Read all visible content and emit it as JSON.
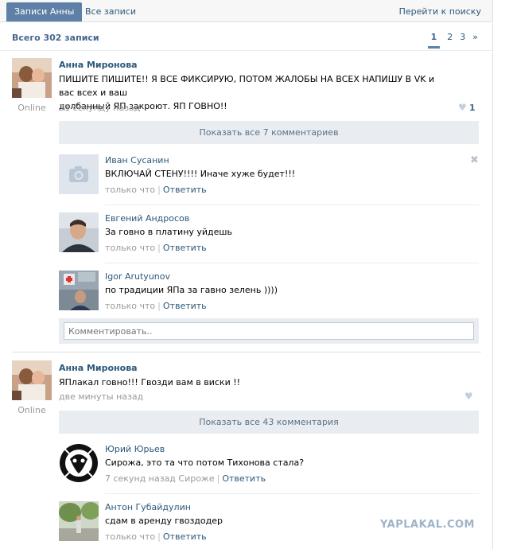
{
  "tabs": {
    "active": "Записи Анны",
    "all": "Все записи",
    "search": "Перейти к поиску"
  },
  "summary": {
    "total": "Всего 302 записи"
  },
  "pager": {
    "pages": [
      "1",
      "2",
      "3",
      "»"
    ],
    "current": "1"
  },
  "posts": [
    {
      "author": "Анна Миронова",
      "status": "Online",
      "text_line1": "ПИШИТЕ ПИШИТЕ!! Я ВСЕ ФИКСИРУЮ, ПОТОМ ЖАЛОБЫ НА ВСЕХ НАПИШУ В VK и вас всех и ваш",
      "text_line2": "долбанный ЯП закроют. ЯП ГОВНО!!",
      "time": "31 секунду назад",
      "likes": "1",
      "show_all": "Показать все 7 комментариев",
      "comments": [
        {
          "author": "Иван Сусанин",
          "text": "ВКЛЮЧАЙ СТЕНУ!!!! Иначе хуже будет!!!",
          "time": "только что",
          "reply": "Ответить"
        },
        {
          "author": "Евгений Андросов",
          "text": "За говно в платину уйдешь",
          "time": "только что",
          "reply": "Ответить"
        },
        {
          "author": "Igor Arutyunov",
          "text": "по традиции ЯПа за гавно зелень ))))",
          "time": "только что",
          "reply": "Ответить"
        }
      ],
      "comment_placeholder": "Комментировать.."
    },
    {
      "author": "Анна Миронова",
      "status": "Online",
      "text_line1": "ЯПлакал говно!!! Гвозди вам в виски !!",
      "time": "две минуты назад",
      "show_all": "Показать все 43 комментария",
      "comments": [
        {
          "author": "Юрий Юрьев",
          "text": "Сирожа, это та что потом Тихонова стала?",
          "time": "7 секунд назад Сироже",
          "reply": "Ответить"
        },
        {
          "author": "Антон Губайдулин",
          "text": "сдам в аренду гвоздодер",
          "time": "только что",
          "reply": "Ответить"
        }
      ]
    }
  ],
  "watermark": "YAPLAKAL.COM",
  "colors": {
    "link": "#2b587a",
    "tab_active_bg": "#5e80a6",
    "muted": "#999999",
    "bar_bg": "#e9edf1"
  },
  "icons": {
    "like": "heart-icon",
    "close": "close-icon",
    "camera": "camera-icon"
  }
}
